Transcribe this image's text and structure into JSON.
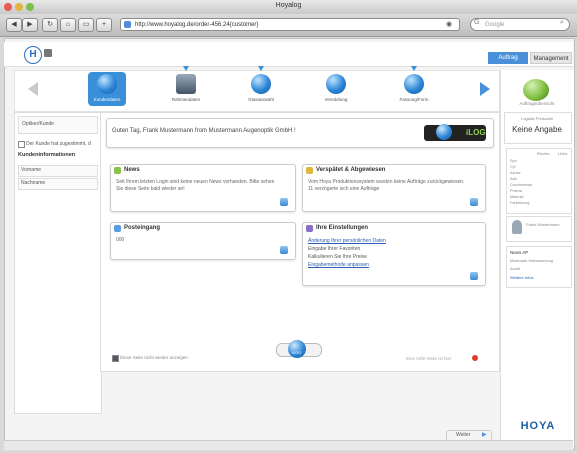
{
  "window": {
    "title": "Hoyalog"
  },
  "browser": {
    "url": "http://www.hoyalog.de/order-456.24{customer}",
    "search_placeholder": "Google"
  },
  "app": {
    "logo_letter": "H",
    "tabs": [
      {
        "label": "Auftrag"
      },
      {
        "label": "Management"
      }
    ]
  },
  "process_steps": [
    {
      "label": "Kundendaten"
    },
    {
      "label": "Rahmendaten"
    },
    {
      "label": "Glasauswahl"
    },
    {
      "label": "Veredelung"
    },
    {
      "label": "Fassung/Form"
    }
  ],
  "left_panel": {
    "search_label": "Optiker/Kunde",
    "checkbox_label": "Der Kunde hat zugestimmt, d",
    "section_title": "Kundeninformationen",
    "fields": [
      {
        "label": "Vorname"
      },
      {
        "label": "Nachname"
      }
    ]
  },
  "greeting": {
    "text": "Guten Tag, Frank Mustermann from Mustermann Augenoptik GmbH !",
    "logo_text": "iLOG"
  },
  "cards": {
    "news": {
      "title": "News",
      "text": "Seit Ihrem letzten Login sind keine neuen News vorhanden. Bitte sehen Sie diese Seite bald wieder an!"
    },
    "verspaetet": {
      "title": "Verspätet & Abgewiesen",
      "text": "Vom Hoya Produktionssystem wurden keine Aufträge zurückgewiesen. 11 verzögerte sich eine Aufträge"
    },
    "posteingang": {
      "title": "Posteingang",
      "text": "000"
    },
    "einstellungen": {
      "title": "Ihre Einstellungen",
      "lines": [
        {
          "text": "Änderung Ihrer persönlichen Daten",
          "link": true
        },
        {
          "text": "Eingabe Ihrer Favoriten",
          "link": false
        },
        {
          "text": "Kalkulieren Sie Ihre Preise",
          "link": false
        },
        {
          "text": "Eingabemethode anpassen",
          "link": true
        }
      ]
    }
  },
  "main_footer": {
    "left_text": "Diese Seite nicht wieder anzeigen",
    "right_text": "Eine Hilfe-Seite ist hier",
    "center_label": "iLOG"
  },
  "right_panel": {
    "step_label": "Auftragsübersicht",
    "status_small": "Logistik Preiswahl",
    "status_big": "Keine Angabe",
    "list_left": [
      "Sph",
      "Cyl",
      "Achse",
      "Add",
      "Durchmesser",
      "Prisma",
      "Material",
      "Farbtönung"
    ],
    "list_right": [
      "Rechts",
      "Links"
    ],
    "user_label": "Frank Mustermann",
    "news_title": "News AP",
    "news_text": "Maximale Verbesserung",
    "news_sub": "Auslfr.",
    "news_link": "Weitere Infos",
    "brand": "HOYA"
  },
  "bottom_nav": {
    "next_label": "Weiter"
  },
  "colors": {
    "accent": "#2d86d6",
    "link": "#2a5db0",
    "brand": "#1f5fa8",
    "alert": "#e03c2c"
  }
}
